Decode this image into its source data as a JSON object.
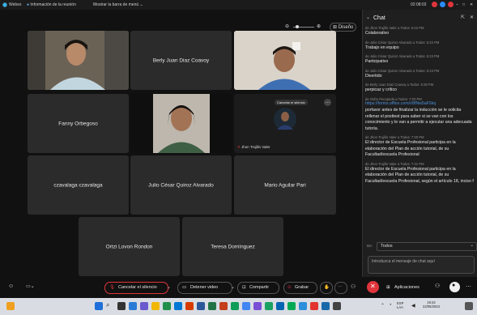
{
  "top_bar": {
    "app": "Webex",
    "meeting_info": "Información de la reunión",
    "show_menu": "Mostrar la barra de menú",
    "time": "02:08:03"
  },
  "view": {
    "layout_label": "Diseño"
  },
  "participants": [
    {
      "name": "",
      "video": true
    },
    {
      "name": "Berly Juan Diaz Coavoy",
      "video": false
    },
    {
      "name": "",
      "video": true
    },
    {
      "name": "Fanny Orbegoso",
      "video": false
    },
    {
      "name": "",
      "video": true
    },
    {
      "name": "Jhon Trujillo Valer",
      "video": true,
      "tag": "Cancelar el silencio"
    },
    {
      "name": "czavalaga czavalaga",
      "video": false
    },
    {
      "name": "Julio César Quiroz Alvarado",
      "video": false
    },
    {
      "name": "Mario Aguilar Pari",
      "video": false
    },
    {
      "name": "Ortzi Lovon Rondon",
      "video": false
    },
    {
      "name": "Teresa Domínguez",
      "video": false
    }
  ],
  "chat": {
    "title": "Chat",
    "messages": [
      {
        "header": "de Jhon Trujillo Valer a Todos:  6:22 PM",
        "text": "Colaborativo"
      },
      {
        "header": "de Julio César Quiroz Alvarado a Todos:  6:22 PM",
        "text": "Trabajo en equipo"
      },
      {
        "header": "de Julio César Quiroz Alvarado a Todos:  6:23 PM",
        "text": "Participativo"
      },
      {
        "header": "de Julio César Quiroz Alvarado a Todos:  6:23 PM",
        "text": "Divertido"
      },
      {
        "header": "de Berly Juan Diaz Coavoy a Todos:  6:28 PM",
        "text": "perpicaz y crítico"
      },
      {
        "header": "de Odón Pocopeda a Todos:  7:03 PM",
        "link": "https://forms.office.com/r/8fNw5aF5kq",
        "text": "porfavor antes de finalizar la inducción se le solicita rellenar el posttest para saber si se van con los conocimiento y le van a permitir a ejecutar una adecuada tutoría."
      },
      {
        "header": "de Jhon Trujillo Valer a Todos:  7:30 PM",
        "text": "El director de Escuela Profesional participa en la elaboración del Plan de acción tutorial, de su Facultad/escuela Profesional"
      },
      {
        "header": "de Jhon Trujillo Valer a Todos:  7:31 PM",
        "text": "El director de Escuela Profesional participa en la elaboración del Plan de acción tutorial, de su Facultad/escuela Profesional, según el artículo 18, inciso f"
      }
    ],
    "to_label": "De:",
    "recipient": "Todos",
    "input_placeholder": "Introduzca el mensaje de chat aquí"
  },
  "controls": {
    "unmute": "Cancelar el silencio",
    "stop_video": "Detener video",
    "share": "Compartir",
    "record": "Grabar",
    "apps": "Aplicaciones"
  },
  "taskbar": {
    "search_placeholder": "Buscar",
    "language": "ESP\nLAA",
    "time": "19:42",
    "date": "22/05/2023"
  },
  "colors": {
    "end_call": "#e0343c",
    "accent": "#4a90d9"
  }
}
